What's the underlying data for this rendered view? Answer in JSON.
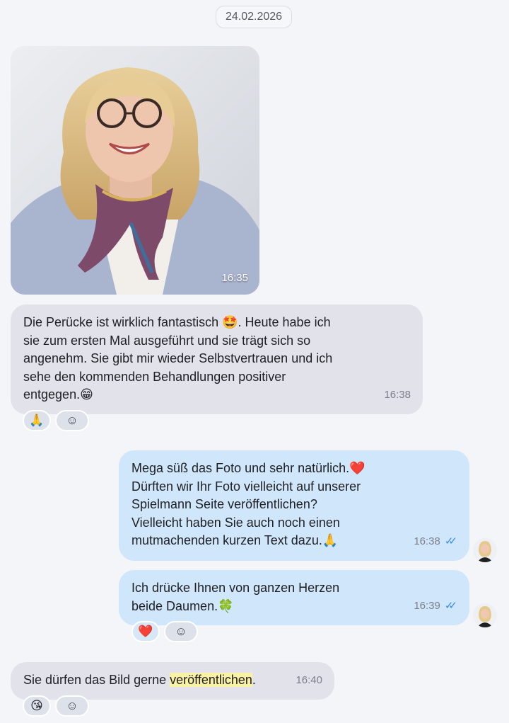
{
  "date_chip": "24.02.2026",
  "messages": [
    {
      "photo_time": "16:35"
    },
    {
      "text": "Die Perücke ist wirklich fantastisch 🤩. Heute habe ich\nsie zum ersten Mal ausgeführt und sie trägt sich so\nangenehm. Sie gibt mir wieder Selbstvertrauen und ich\nsehe den kommenden Behandlungen positiver\nentgegen.😁",
      "time": "16:38",
      "reaction": "🙏"
    },
    {
      "text": "Mega süß das Foto und sehr natürlich.❤️\nDürften wir Ihr Foto vielleicht auf unserer\nSpielmann Seite veröffentlichen?\nVielleicht haben Sie auch noch einen\nmutmachenden kurzen Text dazu.🙏",
      "time": "16:38",
      "status": "✓✓"
    },
    {
      "text": "Ich drücke Ihnen von ganzen Herzen\nbeide Daumen.🍀",
      "time": "16:39",
      "status": "✓✓",
      "reaction": "❤️"
    },
    {
      "text_before": "Sie dürfen das Bild gerne ",
      "text_highlight": "veröffentlichen",
      "text_after": ".",
      "time": "16:40",
      "reaction": "😘"
    }
  ],
  "icons": {
    "add_reaction": "☺",
    "read_status": "double-check-icon"
  },
  "colors": {
    "incoming_bubble": "#e1e2ea",
    "outgoing_bubble": "#cfe6fb",
    "read_ticks": "#3a8ee6",
    "highlight": "#fbf1a5"
  }
}
